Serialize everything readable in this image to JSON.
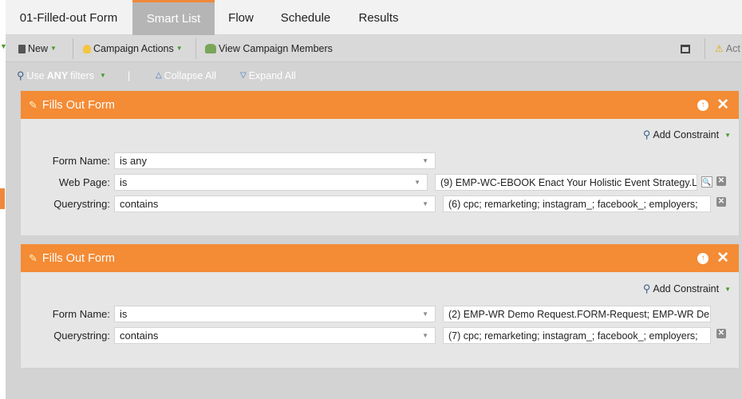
{
  "tabs": [
    {
      "label": "01-Filled-out Form"
    },
    {
      "label": "Smart List"
    },
    {
      "label": "Flow"
    },
    {
      "label": "Schedule"
    },
    {
      "label": "Results"
    }
  ],
  "toolbar": {
    "new_label": "New",
    "campaign_actions_label": "Campaign Actions",
    "view_members_label": "View Campaign Members",
    "act_label": "Act"
  },
  "filterbar": {
    "use_label": "Use",
    "any_label": "ANY",
    "filters_label": "filters",
    "separator": "|",
    "collapse_label": "Collapse All",
    "expand_label": "Expand All"
  },
  "filters": [
    {
      "title": "Fills Out Form",
      "add_constraint": "Add Constraint",
      "rows": [
        {
          "label": "Form Name:",
          "operator": "is any",
          "value": ""
        },
        {
          "label": "Web Page:",
          "operator": "is",
          "value": "(9) EMP-WC-EBOOK Enact Your Holistic Event Strategy.L"
        },
        {
          "label": "Querystring:",
          "operator": "contains",
          "value": "(6) cpc; remarketing; instagram_; facebook_; employers;"
        }
      ]
    },
    {
      "title": "Fills Out Form",
      "add_constraint": "Add Constraint",
      "rows": [
        {
          "label": "Form Name:",
          "operator": "is",
          "value": "(2) EMP-WR Demo Request.FORM-Request; EMP-WR Der"
        },
        {
          "label": "Querystring:",
          "operator": "contains",
          "value": "(7) cpc; remarketing; instagram_; facebook_; employers;"
        }
      ]
    }
  ]
}
